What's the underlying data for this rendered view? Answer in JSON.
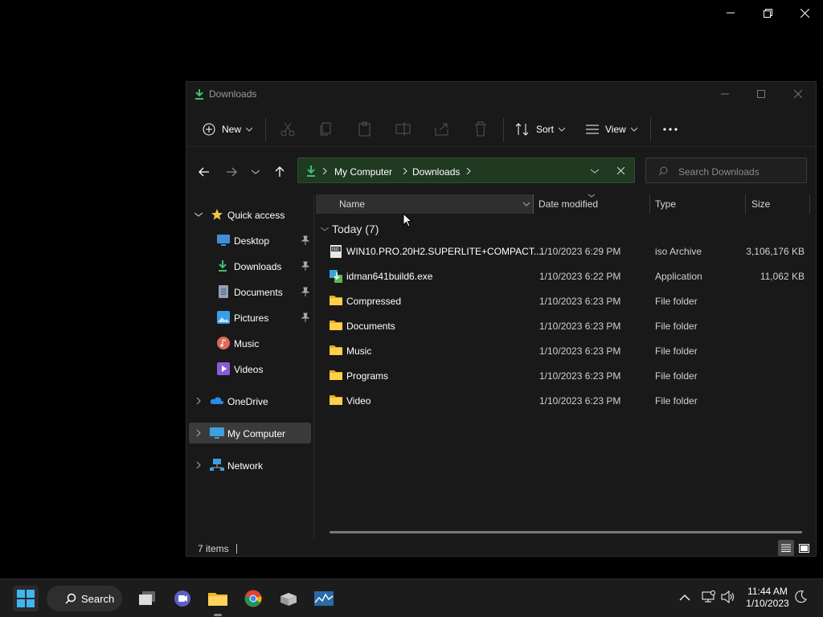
{
  "window": {
    "title": "Downloads"
  },
  "toolbar": {
    "new_label": "New",
    "sort_label": "Sort",
    "view_label": "View"
  },
  "address": {
    "crumb1": "My Computer",
    "crumb2": "Downloads"
  },
  "search": {
    "placeholder": "Search Downloads"
  },
  "sidebar": {
    "quick_access": "Quick access",
    "desktop": "Desktop",
    "downloads": "Downloads",
    "documents": "Documents",
    "pictures": "Pictures",
    "music": "Music",
    "videos": "Videos",
    "onedrive": "OneDrive",
    "my_computer": "My Computer",
    "network": "Network"
  },
  "columns": {
    "name": "Name",
    "date": "Date modified",
    "type": "Type",
    "size": "Size"
  },
  "group": {
    "label": "Today (7)"
  },
  "files": [
    {
      "name": "WIN10.PRO.20H2.SUPERLITE+COMPACT....",
      "date": "1/10/2023 6:29 PM",
      "type": "iso Archive",
      "size": "3,106,176 KB",
      "icon": "iso-file-icon"
    },
    {
      "name": "idman641build6.exe",
      "date": "1/10/2023 6:22 PM",
      "type": "Application",
      "size": "11,062 KB",
      "icon": "exe-file-icon"
    },
    {
      "name": "Compressed",
      "date": "1/10/2023 6:23 PM",
      "type": "File folder",
      "size": "",
      "icon": "folder-icon"
    },
    {
      "name": "Documents",
      "date": "1/10/2023 6:23 PM",
      "type": "File folder",
      "size": "",
      "icon": "folder-icon"
    },
    {
      "name": "Music",
      "date": "1/10/2023 6:23 PM",
      "type": "File folder",
      "size": "",
      "icon": "folder-icon"
    },
    {
      "name": "Programs",
      "date": "1/10/2023 6:23 PM",
      "type": "File folder",
      "size": "",
      "icon": "folder-icon"
    },
    {
      "name": "Video",
      "date": "1/10/2023 6:23 PM",
      "type": "File folder",
      "size": "",
      "icon": "folder-icon"
    }
  ],
  "status": {
    "items": "7 items"
  },
  "taskbar": {
    "search_label": "Search",
    "time": "11:44 AM",
    "date": "1/10/2023"
  },
  "colors": {
    "accent": "#4cc2ff",
    "folder": "#f5c542",
    "address_bg": "#203a22"
  }
}
